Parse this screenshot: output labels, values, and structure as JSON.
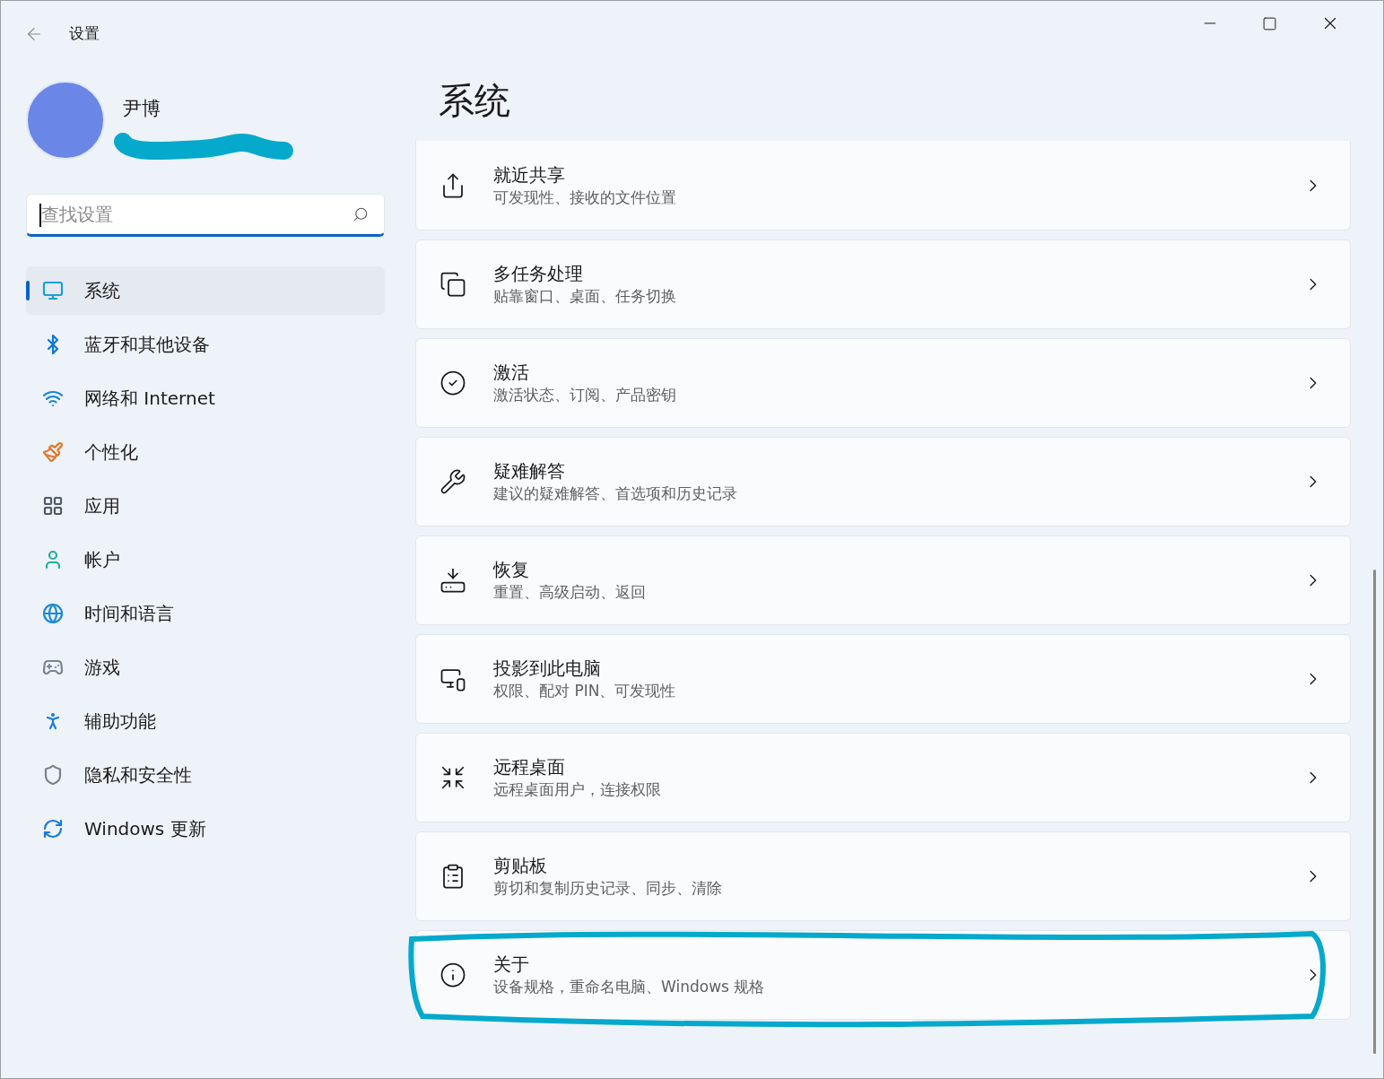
{
  "window": {
    "title": "设置"
  },
  "profile": {
    "name": "尹博"
  },
  "search": {
    "placeholder": "查找设置"
  },
  "sidebar": {
    "items": [
      {
        "label": "系统",
        "selected": true
      },
      {
        "label": "蓝牙和其他设备",
        "selected": false
      },
      {
        "label": "网络和 Internet",
        "selected": false
      },
      {
        "label": "个性化",
        "selected": false
      },
      {
        "label": "应用",
        "selected": false
      },
      {
        "label": "帐户",
        "selected": false
      },
      {
        "label": "时间和语言",
        "selected": false
      },
      {
        "label": "游戏",
        "selected": false
      },
      {
        "label": "辅助功能",
        "selected": false
      },
      {
        "label": "隐私和安全性",
        "selected": false
      },
      {
        "label": "Windows 更新",
        "selected": false
      }
    ]
  },
  "page": {
    "title": "系统"
  },
  "settings": [
    {
      "title": "就近共享",
      "subtitle": "可发现性、接收的文件位置"
    },
    {
      "title": "多任务处理",
      "subtitle": "贴靠窗口、桌面、任务切换"
    },
    {
      "title": "激活",
      "subtitle": "激活状态、订阅、产品密钥"
    },
    {
      "title": "疑难解答",
      "subtitle": "建议的疑难解答、首选项和历史记录"
    },
    {
      "title": "恢复",
      "subtitle": "重置、高级启动、返回"
    },
    {
      "title": "投影到此电脑",
      "subtitle": "权限、配对 PIN、可发现性"
    },
    {
      "title": "远程桌面",
      "subtitle": "远程桌面用户，连接权限"
    },
    {
      "title": "剪贴板",
      "subtitle": "剪切和复制历史记录、同步、清除"
    },
    {
      "title": "关于",
      "subtitle": "设备规格，重命名电脑、Windows 规格"
    }
  ]
}
